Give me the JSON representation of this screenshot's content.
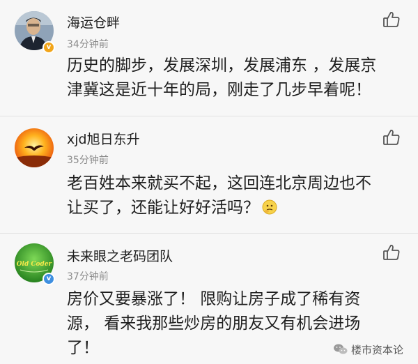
{
  "comments": [
    {
      "username": "海运仓畔",
      "time": "34分钟前",
      "lines": [
        "历史的脚步，发展深圳，发展浦东 ，发展京",
        "津冀这是近十年的局，刚走了几步早着呢！"
      ],
      "avatar_icon": "person-photo-icon",
      "badge_icon": "verified-v-badge-icon",
      "badge_color": "#f2a51a"
    },
    {
      "username": "xjd旭日东升",
      "time": "35分钟前",
      "lines": [
        "老百姓本来就买不起，这回连北京周边也不",
        "让买了，还能让好好活吗？"
      ],
      "avatar_icon": "sunset-eagle-icon",
      "trailing_icon": "thinking-emoji-icon"
    },
    {
      "username": "未来眼之老码团队",
      "time": "37分钟前",
      "lines": [
        "房价又要暴涨了！ 限购让房子成了稀有资",
        "源， 看来我那些炒房的朋友又有机会进场",
        "了！"
      ],
      "avatar_icon": "old-coder-logo-icon",
      "avatar_logo_text": "Old Coder",
      "badge_icon": "verified-v-badge-icon",
      "badge_color": "#3e8fe0"
    }
  ],
  "like_icon": "thumbs-up-icon",
  "watermark": {
    "icon": "wechat-icon",
    "text": "楼市资本论"
  }
}
